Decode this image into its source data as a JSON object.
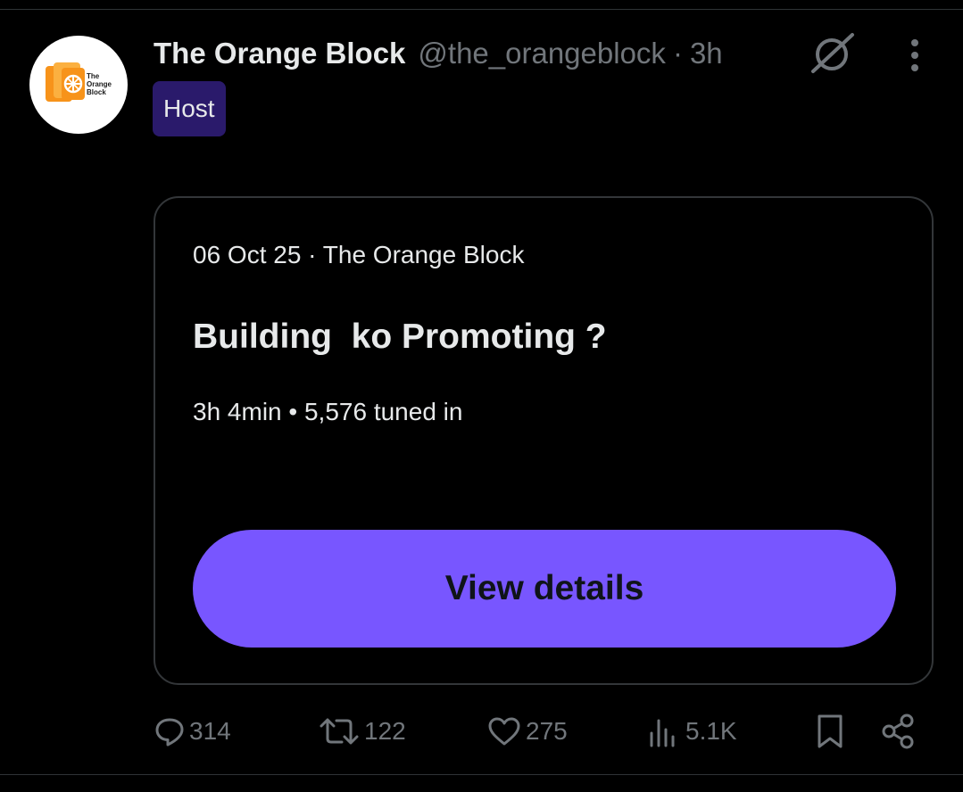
{
  "post": {
    "author": {
      "display_name": "The Orange Block",
      "handle": "@the_orangeblock",
      "time": "3h",
      "separator": "·",
      "avatar_logo_text": "The Orange Block"
    },
    "role_badge": "Host",
    "space_card": {
      "meta": "06 Oct 25 · The Orange Block",
      "title": "Building  ko Promoting ?",
      "stats": "3h 4min • 5,576 tuned in",
      "button_label": "View details"
    },
    "actions": {
      "replies": "314",
      "reposts": "122",
      "likes": "275",
      "views": "5.1K"
    }
  },
  "icons": {
    "header_right": [
      "spaces-muted-icon",
      "more-icon"
    ],
    "actions": [
      "reply-icon",
      "repost-icon",
      "like-icon",
      "views-icon",
      "bookmark-icon",
      "share-icon"
    ]
  },
  "colors": {
    "background": "#000000",
    "text_primary": "#e7e9ea",
    "text_secondary": "#71767b",
    "border": "#333639",
    "host_badge_bg": "#2a1a6b",
    "button_accent": "#7856ff",
    "button_text": "#0f1419",
    "brand_orange": "#f7931a"
  }
}
